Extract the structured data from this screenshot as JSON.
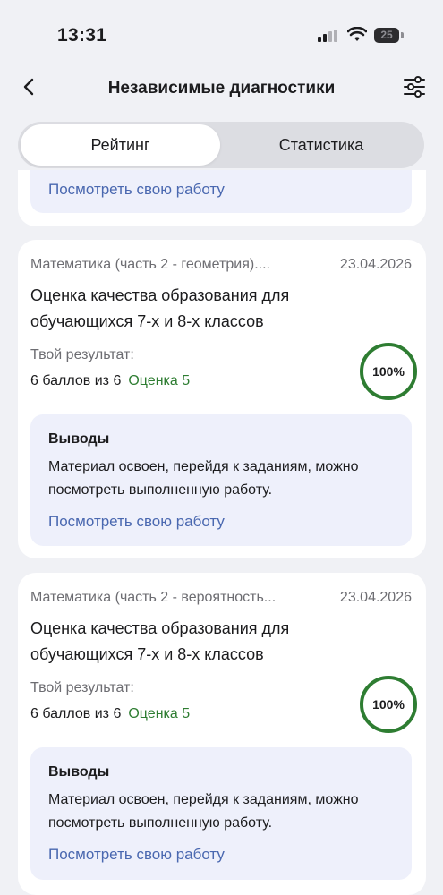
{
  "status_bar": {
    "time": "13:31",
    "battery": "25",
    "icons": [
      "signal-icon",
      "wifi-icon",
      "battery-icon"
    ]
  },
  "header": {
    "title": "Независимые диагностики",
    "back_icon": "chevron-left-icon",
    "filter_icon": "sliders-icon"
  },
  "tabs": [
    {
      "label": "Рейтинг",
      "active": true
    },
    {
      "label": "Статистика",
      "active": false
    }
  ],
  "top_card": {
    "link": "Посмотреть свою работу"
  },
  "cards": [
    {
      "subject": "Математика (часть 2 - геометрия)....",
      "date": "23.04.2026",
      "title": "Оценка качества образования для обучающихся 7-х и 8-х классов",
      "result_label": "Твой результат:",
      "score": "6 баллов из 6",
      "grade": "Оценка 5",
      "percent": "100%",
      "conclusions_title": "Выводы",
      "conclusions_text": "Материал освоен, перейдя к заданиям, можно посмотреть выполненную работу.",
      "link": "Посмотреть свою работу"
    },
    {
      "subject": "Математика (часть 2 - вероятность...",
      "date": "23.04.2026",
      "title": "Оценка качества образования для обучающихся 7-х и 8-х классов",
      "result_label": "Твой результат:",
      "score": "6 баллов из 6",
      "grade": "Оценка 5",
      "percent": "100%",
      "conclusions_title": "Выводы",
      "conclusions_text": "Материал освоен, перейдя к заданиям, можно посмотреть выполненную работу.",
      "link": "Посмотреть свою работу"
    }
  ],
  "colors": {
    "accent_link": "#4a68b0",
    "grade_green": "#2e7d32",
    "background": "#f0f1f5",
    "conclusions_bg": "#eef0fb"
  }
}
